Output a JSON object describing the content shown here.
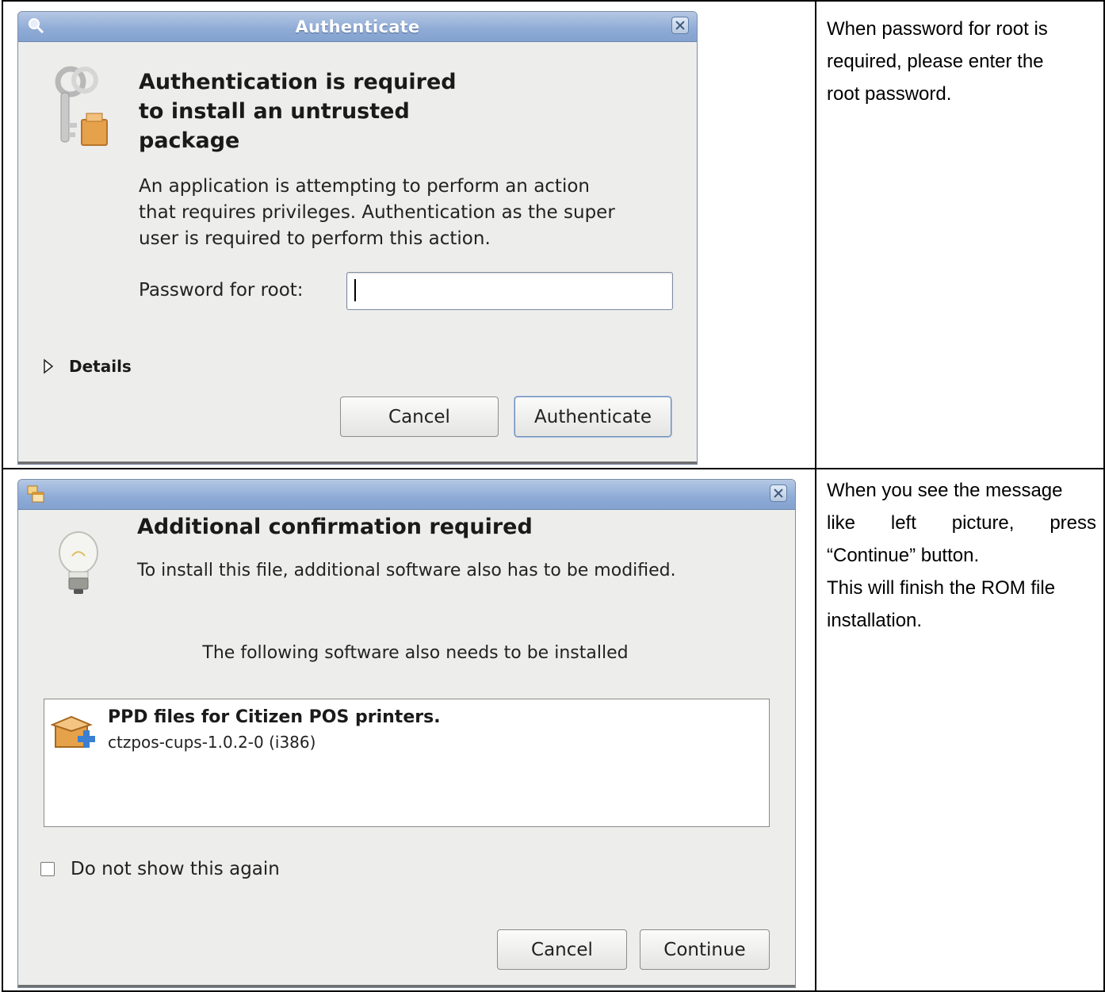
{
  "auth_dialog": {
    "title": "Authenticate",
    "heading": [
      "Authentication is required",
      "to install an untrusted",
      "package"
    ],
    "message": [
      "An application is attempting to perform an action",
      "that requires privileges. Authentication as the super",
      "user is required to perform this action."
    ],
    "password_label": "Password for root:",
    "password_value": "",
    "details_label": "Details",
    "cancel_label": "Cancel",
    "authenticate_label": "Authenticate"
  },
  "auth_note": [
    "When password for root is",
    "required, please enter the",
    "root password."
  ],
  "confirm_dialog": {
    "title": "",
    "heading": "Additional confirmation required",
    "message": "To install this file, additional software also has to be modified.",
    "sub_message": "The following software also needs to be installed",
    "packages": [
      {
        "name": "PPD files for Citizen POS printers.",
        "version": "ctzpos-cups-1.0.2-0 (i386)"
      }
    ],
    "dont_show_label": "Do not show this again",
    "dont_show_checked": false,
    "cancel_label": "Cancel",
    "continue_label": "Continue"
  },
  "confirm_note": {
    "line1": "When you see the message",
    "line2": "like left picture, press",
    "line3": "“Continue” button.",
    "line4": "This will finish the ROM file",
    "line5": "installation."
  },
  "icons": {
    "auth_title": "magnifier-icon",
    "auth_main": "keys-package-icon",
    "details": "expander-triangle-icon",
    "confirm_title": "window-stack-icon",
    "confirm_main": "lightbulb-icon",
    "package": "package-add-icon"
  }
}
